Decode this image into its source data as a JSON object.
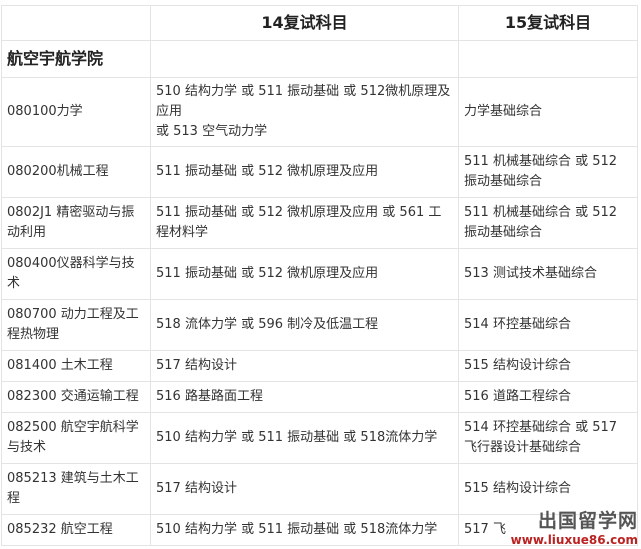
{
  "header": {
    "col1": "",
    "col2": "14复试科目",
    "col3": "15复试科目"
  },
  "section": {
    "title": "航空宇航学院"
  },
  "rows": [
    {
      "major": "080100力学",
      "y14": "510 结构力学 或 511 振动基础 或 512微机原理及应用\n或 513 空气动力学",
      "y15": "力学基础综合"
    },
    {
      "major": "080200机械工程",
      "y14": "511 振动基础 或 512 微机原理及应用",
      "y15": "511 机械基础综合 或 512 振动基础综合"
    },
    {
      "major": "0802J1 精密驱动与振动利用",
      "y14": "511 振动基础 或 512 微机原理及应用 或 561 工程材料学",
      "y15": "511 机械基础综合 或 512 振动基础综合"
    },
    {
      "major": "080400仪器科学与技术",
      "y14": "511 振动基础 或 512 微机原理及应用",
      "y15": "513 测试技术基础综合"
    },
    {
      "major": "080700 动力工程及工程热物理",
      "y14": "518 流体力学 或 596 制冷及低温工程",
      "y15": "514 环控基础综合"
    },
    {
      "major": "081400 土木工程",
      "y14": "517 结构设计",
      "y15": "515 结构设计综合"
    },
    {
      "major": "082300 交通运输工程",
      "y14": "516 路基路面工程",
      "y15": "516 道路工程综合"
    },
    {
      "major": "082500 航空宇航科学与技术",
      "y14": "510 结构力学 或 511 振动基础 或 518流体力学",
      "y15": "514 环控基础综合 或 517 飞行器设计基础综合"
    },
    {
      "major": "085213 建筑与土木工程",
      "y14": "517 结构设计",
      "y15": "515 结构设计综合"
    },
    {
      "major": "085232 航空工程",
      "y14": "510 结构力学 或 511 振动基础 或 518流体力学",
      "y15": "517 飞"
    }
  ],
  "watermark": {
    "name": "出国留学网",
    "url": "www.liuxue86.com"
  }
}
